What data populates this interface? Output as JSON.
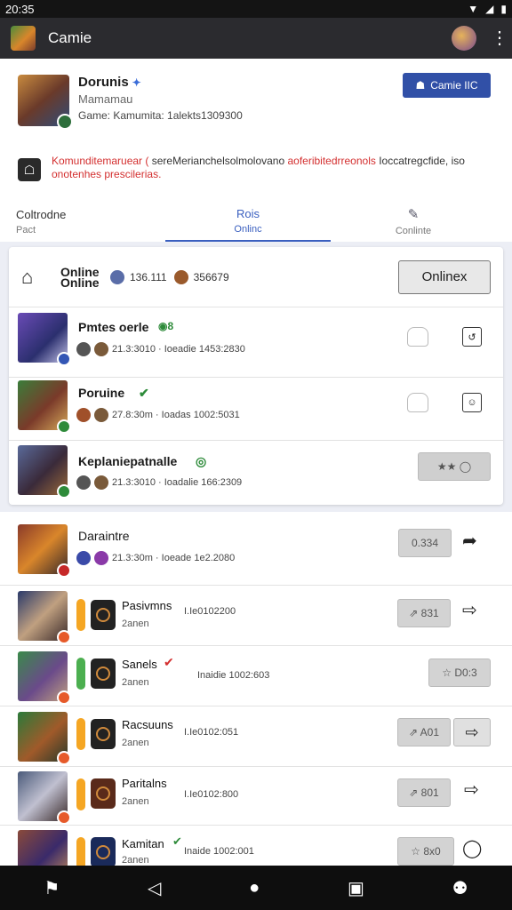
{
  "status": {
    "time": "20:35",
    "wifi": "▼",
    "signal": "◢",
    "battery": "▮"
  },
  "appbar": {
    "title": "Camie",
    "menu_icon": "⋮"
  },
  "profile": {
    "name": "Dorunis",
    "verified_icon": "✦",
    "subtitle": "Mamamau",
    "meta": "Game: Kamumita: 1alekts1309300",
    "follow_label": "Camie IIC",
    "follow_icon": "☗",
    "notice_icon": "☖",
    "notice_red_1": "Komunditemaruear (",
    "notice_dark_1": " sereMerianchelsolmolovano ",
    "notice_red_2": "aoferibitedrreonols",
    "notice_dark_2": " Ioccatregcfide, iso",
    "notice_red_3": "onotenhes prescilerias."
  },
  "tabs": [
    {
      "label": "Coltrodne",
      "sub": "Pact",
      "icon": ""
    },
    {
      "label": "Rois",
      "sub": "Onlinc",
      "icon": ""
    },
    {
      "label": "",
      "sub": "Conlinte",
      "icon": "✎"
    }
  ],
  "online_card": {
    "title": "Online Online",
    "home_icon": "⌂",
    "stat1": "136.111",
    "stat2": "356679",
    "button": "Onlinex",
    "rows": [
      {
        "title": "Pmtes oerle",
        "badge": "◉8",
        "meta": "21.3:3010 · Ioeadie 1453:2830",
        "a1": "⌂",
        "a2": "↺"
      },
      {
        "title": "Poruine",
        "badge": "✔",
        "meta": "27.8:30m · Ioadas 1002:5031",
        "a1": "⌂",
        "a2": "☺"
      },
      {
        "title": "Keplaniepatnalle",
        "badge": "◎",
        "meta": "21.3:3010 · Ioadalie 166:2309",
        "pill": "★★ ◯"
      }
    ]
  },
  "list": [
    {
      "title": "Daraintre",
      "meta": "21.3:30m · Ioeade 1e2.2080",
      "pill": "0.334",
      "share": "➦"
    },
    {
      "title": "Pasivmns",
      "sub": "2anen",
      "mid": "I.Ie0102200",
      "pill": "⇗ 831",
      "share": "⇨"
    },
    {
      "title": "Sanels",
      "sub": "2anen",
      "mid": "Inaidie 1002:603",
      "pill": "☆ D0:3",
      "share": ""
    },
    {
      "title": "Racsuuns",
      "sub": "2anen",
      "mid": "I.Ie0102:051",
      "pill": "⇗ A01",
      "share": "⇨"
    },
    {
      "title": "Paritalns",
      "sub": "2anen",
      "mid": "I.Ie0102:800",
      "pill": "⇗ 801",
      "share": "⇨"
    },
    {
      "title": "Kamitan",
      "sub": "2anen",
      "mid": "Inaide 1002:001",
      "pill": "☆ 8x0",
      "share": "◯"
    }
  ],
  "nav": {
    "back": "◁",
    "home": "●",
    "recent": "▣",
    "profile": "⚉",
    "extra": "⚑"
  }
}
